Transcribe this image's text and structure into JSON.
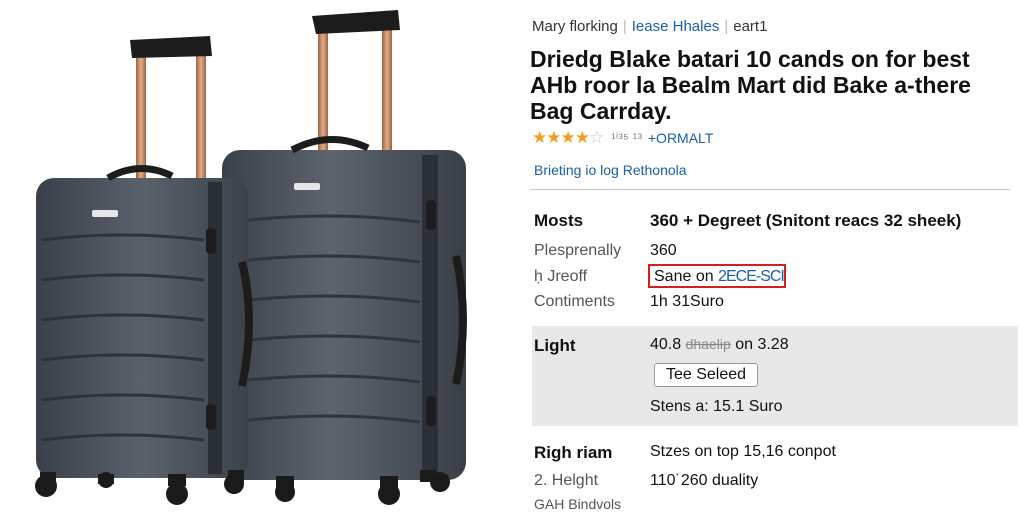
{
  "breadcrumb": {
    "item1": "Mary florking",
    "item2": "Iease Hhales",
    "item3": "eart1"
  },
  "product": {
    "title": "Driedg Blake batari 10 cands on for best AHb roor la Bealm Mart did Bake a-there Bag Carrday.",
    "rating_value": 4,
    "rating_max": 5,
    "rating_text": "¹ⁱ³⁵ ¹³",
    "format_link": "+ORMALT",
    "help_link": "Brieting io log Rethonola"
  },
  "specs": {
    "row1_label": "Mosts",
    "row1_value": "360 + Degreet (Snitont reacs 32 sheek)",
    "row2_label": "Plesprenally",
    "row2_value": "360",
    "row3_label": "ḥ Jreoff",
    "row3_prefix": "Sane on",
    "row3_link": "2ECE-SCI",
    "row4_label": "Contiments",
    "row4_value": "1h 31Suro"
  },
  "panel": {
    "label": "Light",
    "value_prefix": "40.8",
    "value_strike": "dhaelip",
    "value_suffix": "on 3.28",
    "button_label": "Tee Seleed",
    "price_line": "Stens a: 15.1 Suro"
  },
  "more": {
    "row1_label": "Righ riam",
    "row1_value": "Stzes on top 15,16 conpot",
    "row2_label": "2. Helght",
    "row2_value": "110˙260 duality",
    "row3_label": "GAH Bindvols"
  },
  "colors": {
    "link": "#1a5fa8",
    "highlight": "#d31f1f",
    "star": "#f0a020",
    "panel": "#e8e8e8",
    "luggage": "#4a515b",
    "handle": "#c48a68"
  }
}
